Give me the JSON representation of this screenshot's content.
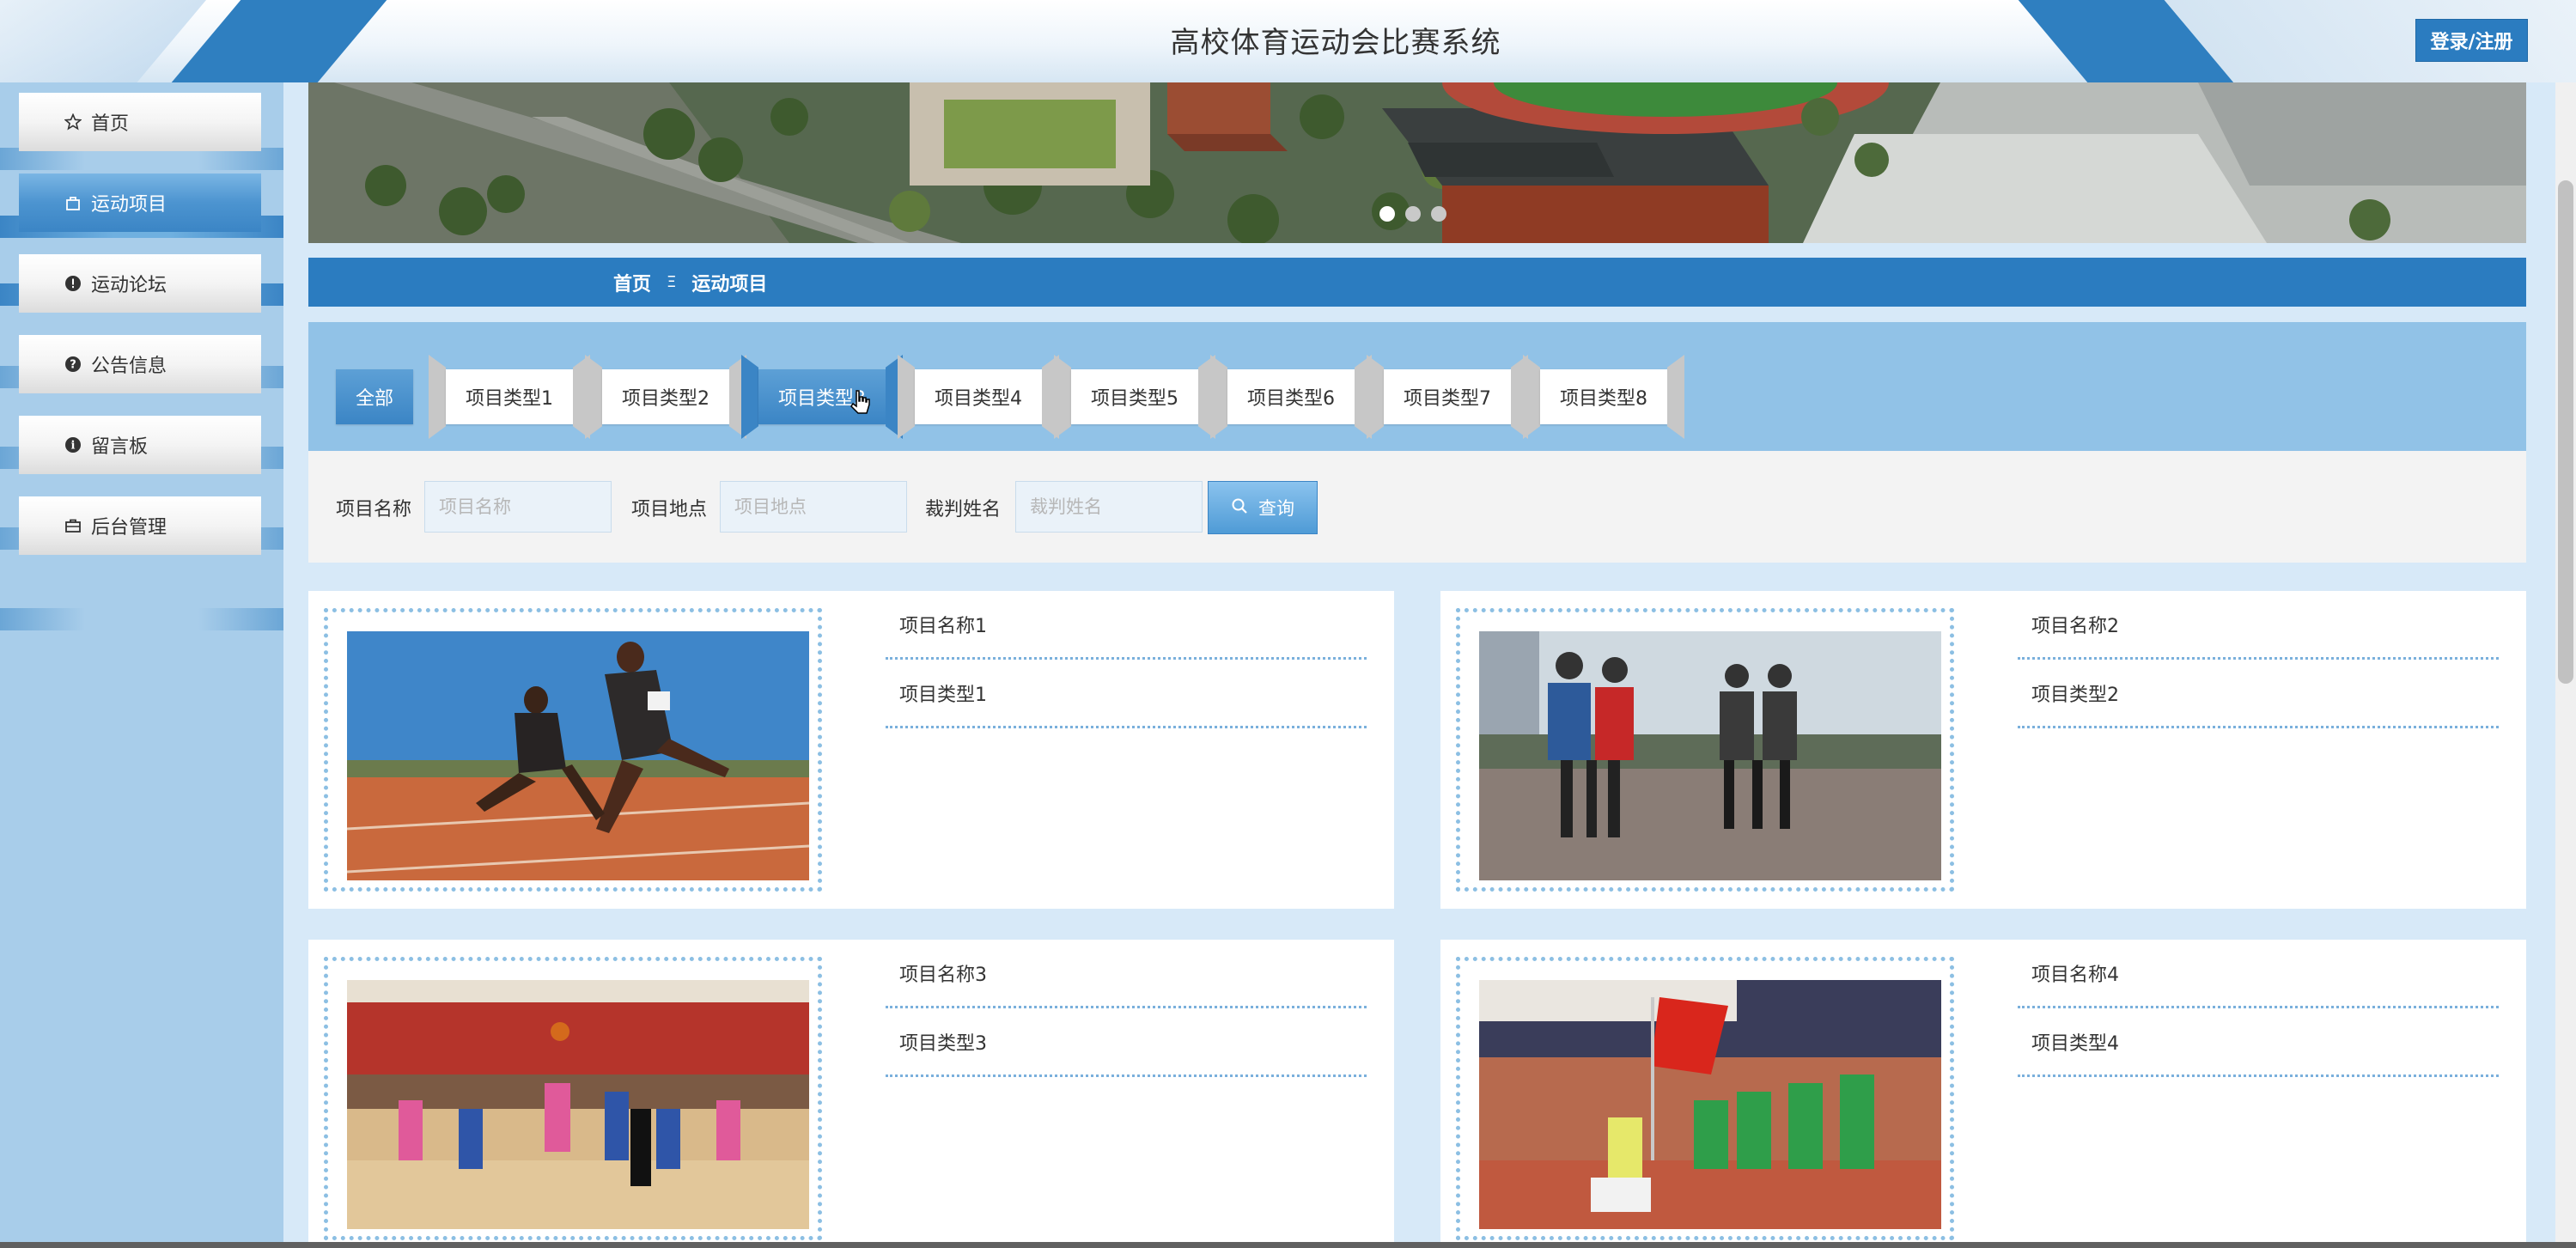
{
  "header": {
    "title": "高校体育运动会比赛系统",
    "login_label": "登录/注册"
  },
  "sidebar": {
    "items": [
      {
        "label": "首页",
        "icon": "star-outline-icon"
      },
      {
        "label": "运动项目",
        "icon": "bag-icon"
      },
      {
        "label": "运动论坛",
        "icon": "exclamation-circle-icon"
      },
      {
        "label": "公告信息",
        "icon": "question-circle-icon"
      },
      {
        "label": "留言板",
        "icon": "info-circle-icon"
      },
      {
        "label": "后台管理",
        "icon": "briefcase-icon"
      }
    ],
    "active_index": 1
  },
  "carousel": {
    "dot_count": 3,
    "active_dot": 0
  },
  "breadcrumb": {
    "home": "首页",
    "separator": "Ξ",
    "current": "运动项目"
  },
  "filter_tabs": [
    "全部",
    "项目类型1",
    "项目类型2",
    "项目类型3",
    "项目类型4",
    "项目类型5",
    "项目类型6",
    "项目类型7",
    "项目类型8"
  ],
  "search": {
    "name_label": "项目名称",
    "name_placeholder": "项目名称",
    "place_label": "项目地点",
    "place_placeholder": "项目地点",
    "referee_label": "裁判姓名",
    "referee_placeholder": "裁判姓名",
    "button_label": "查询"
  },
  "items": [
    {
      "name": "项目名称1",
      "type": "项目类型1",
      "photo": "sprint-finish-photo"
    },
    {
      "name": "项目名称2",
      "type": "项目类型2",
      "photo": "three-legged-race-photo"
    },
    {
      "name": "项目名称3",
      "type": "项目类型3",
      "photo": "basketball-game-photo"
    },
    {
      "name": "项目名称4",
      "type": "项目类型4",
      "photo": "sports-parade-photo"
    }
  ],
  "colors": {
    "primary": "#2b7cc0",
    "sidebar_bg": "#a8cdea",
    "tabs_bg": "#91c2e7",
    "page_bg": "#d7e9f8"
  }
}
